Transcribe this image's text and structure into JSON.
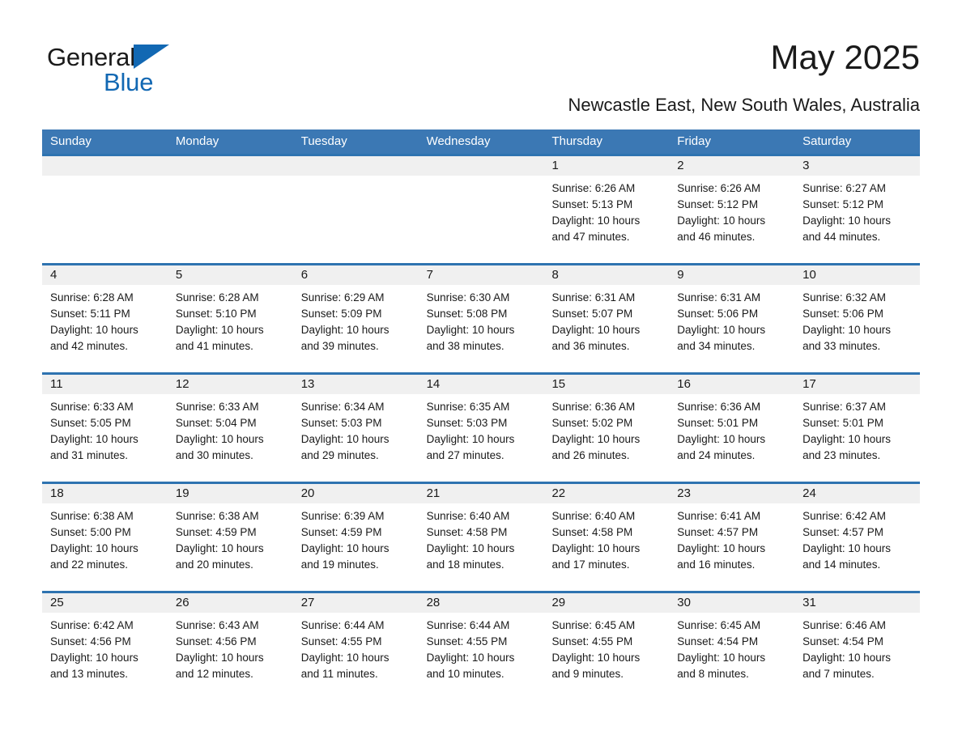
{
  "logo": {
    "text_primary": "General",
    "text_secondary": "Blue",
    "triangle_icon": "triangle-icon",
    "accent_color": "#1268b3"
  },
  "header": {
    "title": "May 2025",
    "subtitle": "Newcastle East, New South Wales, Australia"
  },
  "calendar": {
    "header_bg": "#3b78b4",
    "row_divider_color": "#2e73b0",
    "daynum_band_bg": "#f0f0f0",
    "weekday_headers": [
      "Sunday",
      "Monday",
      "Tuesday",
      "Wednesday",
      "Thursday",
      "Friday",
      "Saturday"
    ],
    "weeks": [
      [
        {
          "day": "",
          "empty": true
        },
        {
          "day": "",
          "empty": true
        },
        {
          "day": "",
          "empty": true
        },
        {
          "day": "",
          "empty": true
        },
        {
          "day": "1",
          "sunrise": "Sunrise: 6:26 AM",
          "sunset": "Sunset: 5:13 PM",
          "daylight_line1": "Daylight: 10 hours",
          "daylight_line2": "and 47 minutes."
        },
        {
          "day": "2",
          "sunrise": "Sunrise: 6:26 AM",
          "sunset": "Sunset: 5:12 PM",
          "daylight_line1": "Daylight: 10 hours",
          "daylight_line2": "and 46 minutes."
        },
        {
          "day": "3",
          "sunrise": "Sunrise: 6:27 AM",
          "sunset": "Sunset: 5:12 PM",
          "daylight_line1": "Daylight: 10 hours",
          "daylight_line2": "and 44 minutes."
        }
      ],
      [
        {
          "day": "4",
          "sunrise": "Sunrise: 6:28 AM",
          "sunset": "Sunset: 5:11 PM",
          "daylight_line1": "Daylight: 10 hours",
          "daylight_line2": "and 42 minutes."
        },
        {
          "day": "5",
          "sunrise": "Sunrise: 6:28 AM",
          "sunset": "Sunset: 5:10 PM",
          "daylight_line1": "Daylight: 10 hours",
          "daylight_line2": "and 41 minutes."
        },
        {
          "day": "6",
          "sunrise": "Sunrise: 6:29 AM",
          "sunset": "Sunset: 5:09 PM",
          "daylight_line1": "Daylight: 10 hours",
          "daylight_line2": "and 39 minutes."
        },
        {
          "day": "7",
          "sunrise": "Sunrise: 6:30 AM",
          "sunset": "Sunset: 5:08 PM",
          "daylight_line1": "Daylight: 10 hours",
          "daylight_line2": "and 38 minutes."
        },
        {
          "day": "8",
          "sunrise": "Sunrise: 6:31 AM",
          "sunset": "Sunset: 5:07 PM",
          "daylight_line1": "Daylight: 10 hours",
          "daylight_line2": "and 36 minutes."
        },
        {
          "day": "9",
          "sunrise": "Sunrise: 6:31 AM",
          "sunset": "Sunset: 5:06 PM",
          "daylight_line1": "Daylight: 10 hours",
          "daylight_line2": "and 34 minutes."
        },
        {
          "day": "10",
          "sunrise": "Sunrise: 6:32 AM",
          "sunset": "Sunset: 5:06 PM",
          "daylight_line1": "Daylight: 10 hours",
          "daylight_line2": "and 33 minutes."
        }
      ],
      [
        {
          "day": "11",
          "sunrise": "Sunrise: 6:33 AM",
          "sunset": "Sunset: 5:05 PM",
          "daylight_line1": "Daylight: 10 hours",
          "daylight_line2": "and 31 minutes."
        },
        {
          "day": "12",
          "sunrise": "Sunrise: 6:33 AM",
          "sunset": "Sunset: 5:04 PM",
          "daylight_line1": "Daylight: 10 hours",
          "daylight_line2": "and 30 minutes."
        },
        {
          "day": "13",
          "sunrise": "Sunrise: 6:34 AM",
          "sunset": "Sunset: 5:03 PM",
          "daylight_line1": "Daylight: 10 hours",
          "daylight_line2": "and 29 minutes."
        },
        {
          "day": "14",
          "sunrise": "Sunrise: 6:35 AM",
          "sunset": "Sunset: 5:03 PM",
          "daylight_line1": "Daylight: 10 hours",
          "daylight_line2": "and 27 minutes."
        },
        {
          "day": "15",
          "sunrise": "Sunrise: 6:36 AM",
          "sunset": "Sunset: 5:02 PM",
          "daylight_line1": "Daylight: 10 hours",
          "daylight_line2": "and 26 minutes."
        },
        {
          "day": "16",
          "sunrise": "Sunrise: 6:36 AM",
          "sunset": "Sunset: 5:01 PM",
          "daylight_line1": "Daylight: 10 hours",
          "daylight_line2": "and 24 minutes."
        },
        {
          "day": "17",
          "sunrise": "Sunrise: 6:37 AM",
          "sunset": "Sunset: 5:01 PM",
          "daylight_line1": "Daylight: 10 hours",
          "daylight_line2": "and 23 minutes."
        }
      ],
      [
        {
          "day": "18",
          "sunrise": "Sunrise: 6:38 AM",
          "sunset": "Sunset: 5:00 PM",
          "daylight_line1": "Daylight: 10 hours",
          "daylight_line2": "and 22 minutes."
        },
        {
          "day": "19",
          "sunrise": "Sunrise: 6:38 AM",
          "sunset": "Sunset: 4:59 PM",
          "daylight_line1": "Daylight: 10 hours",
          "daylight_line2": "and 20 minutes."
        },
        {
          "day": "20",
          "sunrise": "Sunrise: 6:39 AM",
          "sunset": "Sunset: 4:59 PM",
          "daylight_line1": "Daylight: 10 hours",
          "daylight_line2": "and 19 minutes."
        },
        {
          "day": "21",
          "sunrise": "Sunrise: 6:40 AM",
          "sunset": "Sunset: 4:58 PM",
          "daylight_line1": "Daylight: 10 hours",
          "daylight_line2": "and 18 minutes."
        },
        {
          "day": "22",
          "sunrise": "Sunrise: 6:40 AM",
          "sunset": "Sunset: 4:58 PM",
          "daylight_line1": "Daylight: 10 hours",
          "daylight_line2": "and 17 minutes."
        },
        {
          "day": "23",
          "sunrise": "Sunrise: 6:41 AM",
          "sunset": "Sunset: 4:57 PM",
          "daylight_line1": "Daylight: 10 hours",
          "daylight_line2": "and 16 minutes."
        },
        {
          "day": "24",
          "sunrise": "Sunrise: 6:42 AM",
          "sunset": "Sunset: 4:57 PM",
          "daylight_line1": "Daylight: 10 hours",
          "daylight_line2": "and 14 minutes."
        }
      ],
      [
        {
          "day": "25",
          "sunrise": "Sunrise: 6:42 AM",
          "sunset": "Sunset: 4:56 PM",
          "daylight_line1": "Daylight: 10 hours",
          "daylight_line2": "and 13 minutes."
        },
        {
          "day": "26",
          "sunrise": "Sunrise: 6:43 AM",
          "sunset": "Sunset: 4:56 PM",
          "daylight_line1": "Daylight: 10 hours",
          "daylight_line2": "and 12 minutes."
        },
        {
          "day": "27",
          "sunrise": "Sunrise: 6:44 AM",
          "sunset": "Sunset: 4:55 PM",
          "daylight_line1": "Daylight: 10 hours",
          "daylight_line2": "and 11 minutes."
        },
        {
          "day": "28",
          "sunrise": "Sunrise: 6:44 AM",
          "sunset": "Sunset: 4:55 PM",
          "daylight_line1": "Daylight: 10 hours",
          "daylight_line2": "and 10 minutes."
        },
        {
          "day": "29",
          "sunrise": "Sunrise: 6:45 AM",
          "sunset": "Sunset: 4:55 PM",
          "daylight_line1": "Daylight: 10 hours",
          "daylight_line2": "and 9 minutes."
        },
        {
          "day": "30",
          "sunrise": "Sunrise: 6:45 AM",
          "sunset": "Sunset: 4:54 PM",
          "daylight_line1": "Daylight: 10 hours",
          "daylight_line2": "and 8 minutes."
        },
        {
          "day": "31",
          "sunrise": "Sunrise: 6:46 AM",
          "sunset": "Sunset: 4:54 PM",
          "daylight_line1": "Daylight: 10 hours",
          "daylight_line2": "and 7 minutes."
        }
      ]
    ]
  }
}
